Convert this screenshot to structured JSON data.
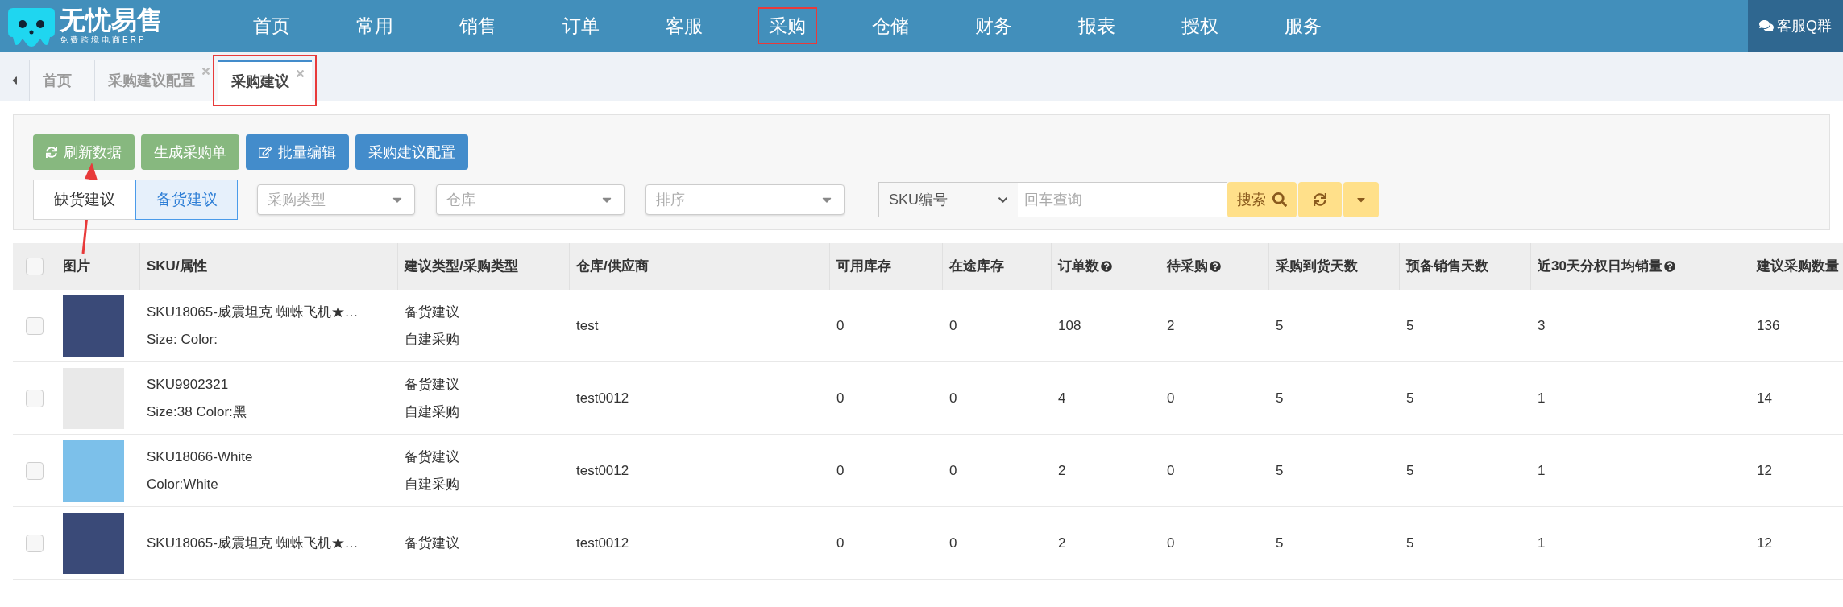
{
  "brand": {
    "name": "无忧易售",
    "tagline": "免费跨境电商ERP"
  },
  "nav": [
    {
      "label": "首页",
      "highlighted": false
    },
    {
      "label": "常用",
      "highlighted": false
    },
    {
      "label": "销售",
      "highlighted": false
    },
    {
      "label": "订单",
      "highlighted": false
    },
    {
      "label": "客服",
      "highlighted": false
    },
    {
      "label": "采购",
      "highlighted": true
    },
    {
      "label": "仓储",
      "highlighted": false
    },
    {
      "label": "财务",
      "highlighted": false
    },
    {
      "label": "报表",
      "highlighted": false
    },
    {
      "label": "授权",
      "highlighted": false
    },
    {
      "label": "服务",
      "highlighted": false
    }
  ],
  "support_button": "客服Q群",
  "tabs": [
    {
      "label": "首页",
      "selected": false,
      "closable": false,
      "highlighted": false
    },
    {
      "label": "采购建议配置",
      "selected": false,
      "closable": true,
      "highlighted": false
    },
    {
      "label": "采购建议",
      "selected": true,
      "closable": true,
      "highlighted": true
    }
  ],
  "actions": [
    {
      "label": "刷新数据",
      "kind": "refresh"
    },
    {
      "label": "生成采购单",
      "kind": "plain"
    },
    {
      "label": "批量编辑",
      "kind": "edit"
    },
    {
      "label": "采购建议配置",
      "kind": "primary"
    }
  ],
  "modes": [
    {
      "label": "缺货建议",
      "selected": false
    },
    {
      "label": "备货建议",
      "selected": true
    }
  ],
  "selects": [
    {
      "placeholder": "采购类型"
    },
    {
      "placeholder": "仓库"
    },
    {
      "placeholder": "排序"
    }
  ],
  "search": {
    "field": "SKU编号",
    "placeholder": "回车查询",
    "button": "搜索"
  },
  "table": {
    "header_checked": false,
    "columns": [
      {
        "label": "图片",
        "help": false
      },
      {
        "label": "SKU/属性",
        "help": false
      },
      {
        "label": "建议类型/采购类型",
        "help": false
      },
      {
        "label": "仓库/供应商",
        "help": false
      },
      {
        "label": "可用库存",
        "help": false
      },
      {
        "label": "在途库存",
        "help": false
      },
      {
        "label": "订单数",
        "help": true
      },
      {
        "label": "待采购",
        "help": true
      },
      {
        "label": "采购到货天数",
        "help": false
      },
      {
        "label": "预备销售天数",
        "help": false
      },
      {
        "label": "近30天分权日均销量",
        "help": true
      },
      {
        "label": "建议采购数量",
        "help": false
      }
    ],
    "rows": [
      {
        "checked": false,
        "sku": "SKU18065-威震坦克 蜘蛛飞机★…",
        "attrs": "Size: Color:",
        "suggestion": "备货建议",
        "purchase_type": "自建采购",
        "supplier": "test",
        "values": [
          "0",
          "0",
          "108",
          "2",
          "5",
          "5",
          "3",
          "136"
        ]
      },
      {
        "checked": false,
        "sku": "SKU9902321",
        "attrs": "Size:38 Color:黑",
        "suggestion": "备货建议",
        "purchase_type": "自建采购",
        "supplier": "test0012",
        "values": [
          "0",
          "0",
          "4",
          "0",
          "5",
          "5",
          "1",
          "14"
        ]
      },
      {
        "checked": false,
        "sku": "SKU18066-White",
        "attrs": "Color:White",
        "suggestion": "备货建议",
        "purchase_type": "自建采购",
        "supplier": "test0012",
        "values": [
          "0",
          "0",
          "2",
          "0",
          "5",
          "5",
          "1",
          "12"
        ]
      },
      {
        "checked": false,
        "sku": "SKU18065-威震坦克 蜘蛛飞机★…",
        "suggestion": "备货建议",
        "supplier": "test0012",
        "values": [
          "0",
          "0",
          "2",
          "0",
          "5",
          "5",
          "1",
          "12"
        ]
      }
    ]
  }
}
